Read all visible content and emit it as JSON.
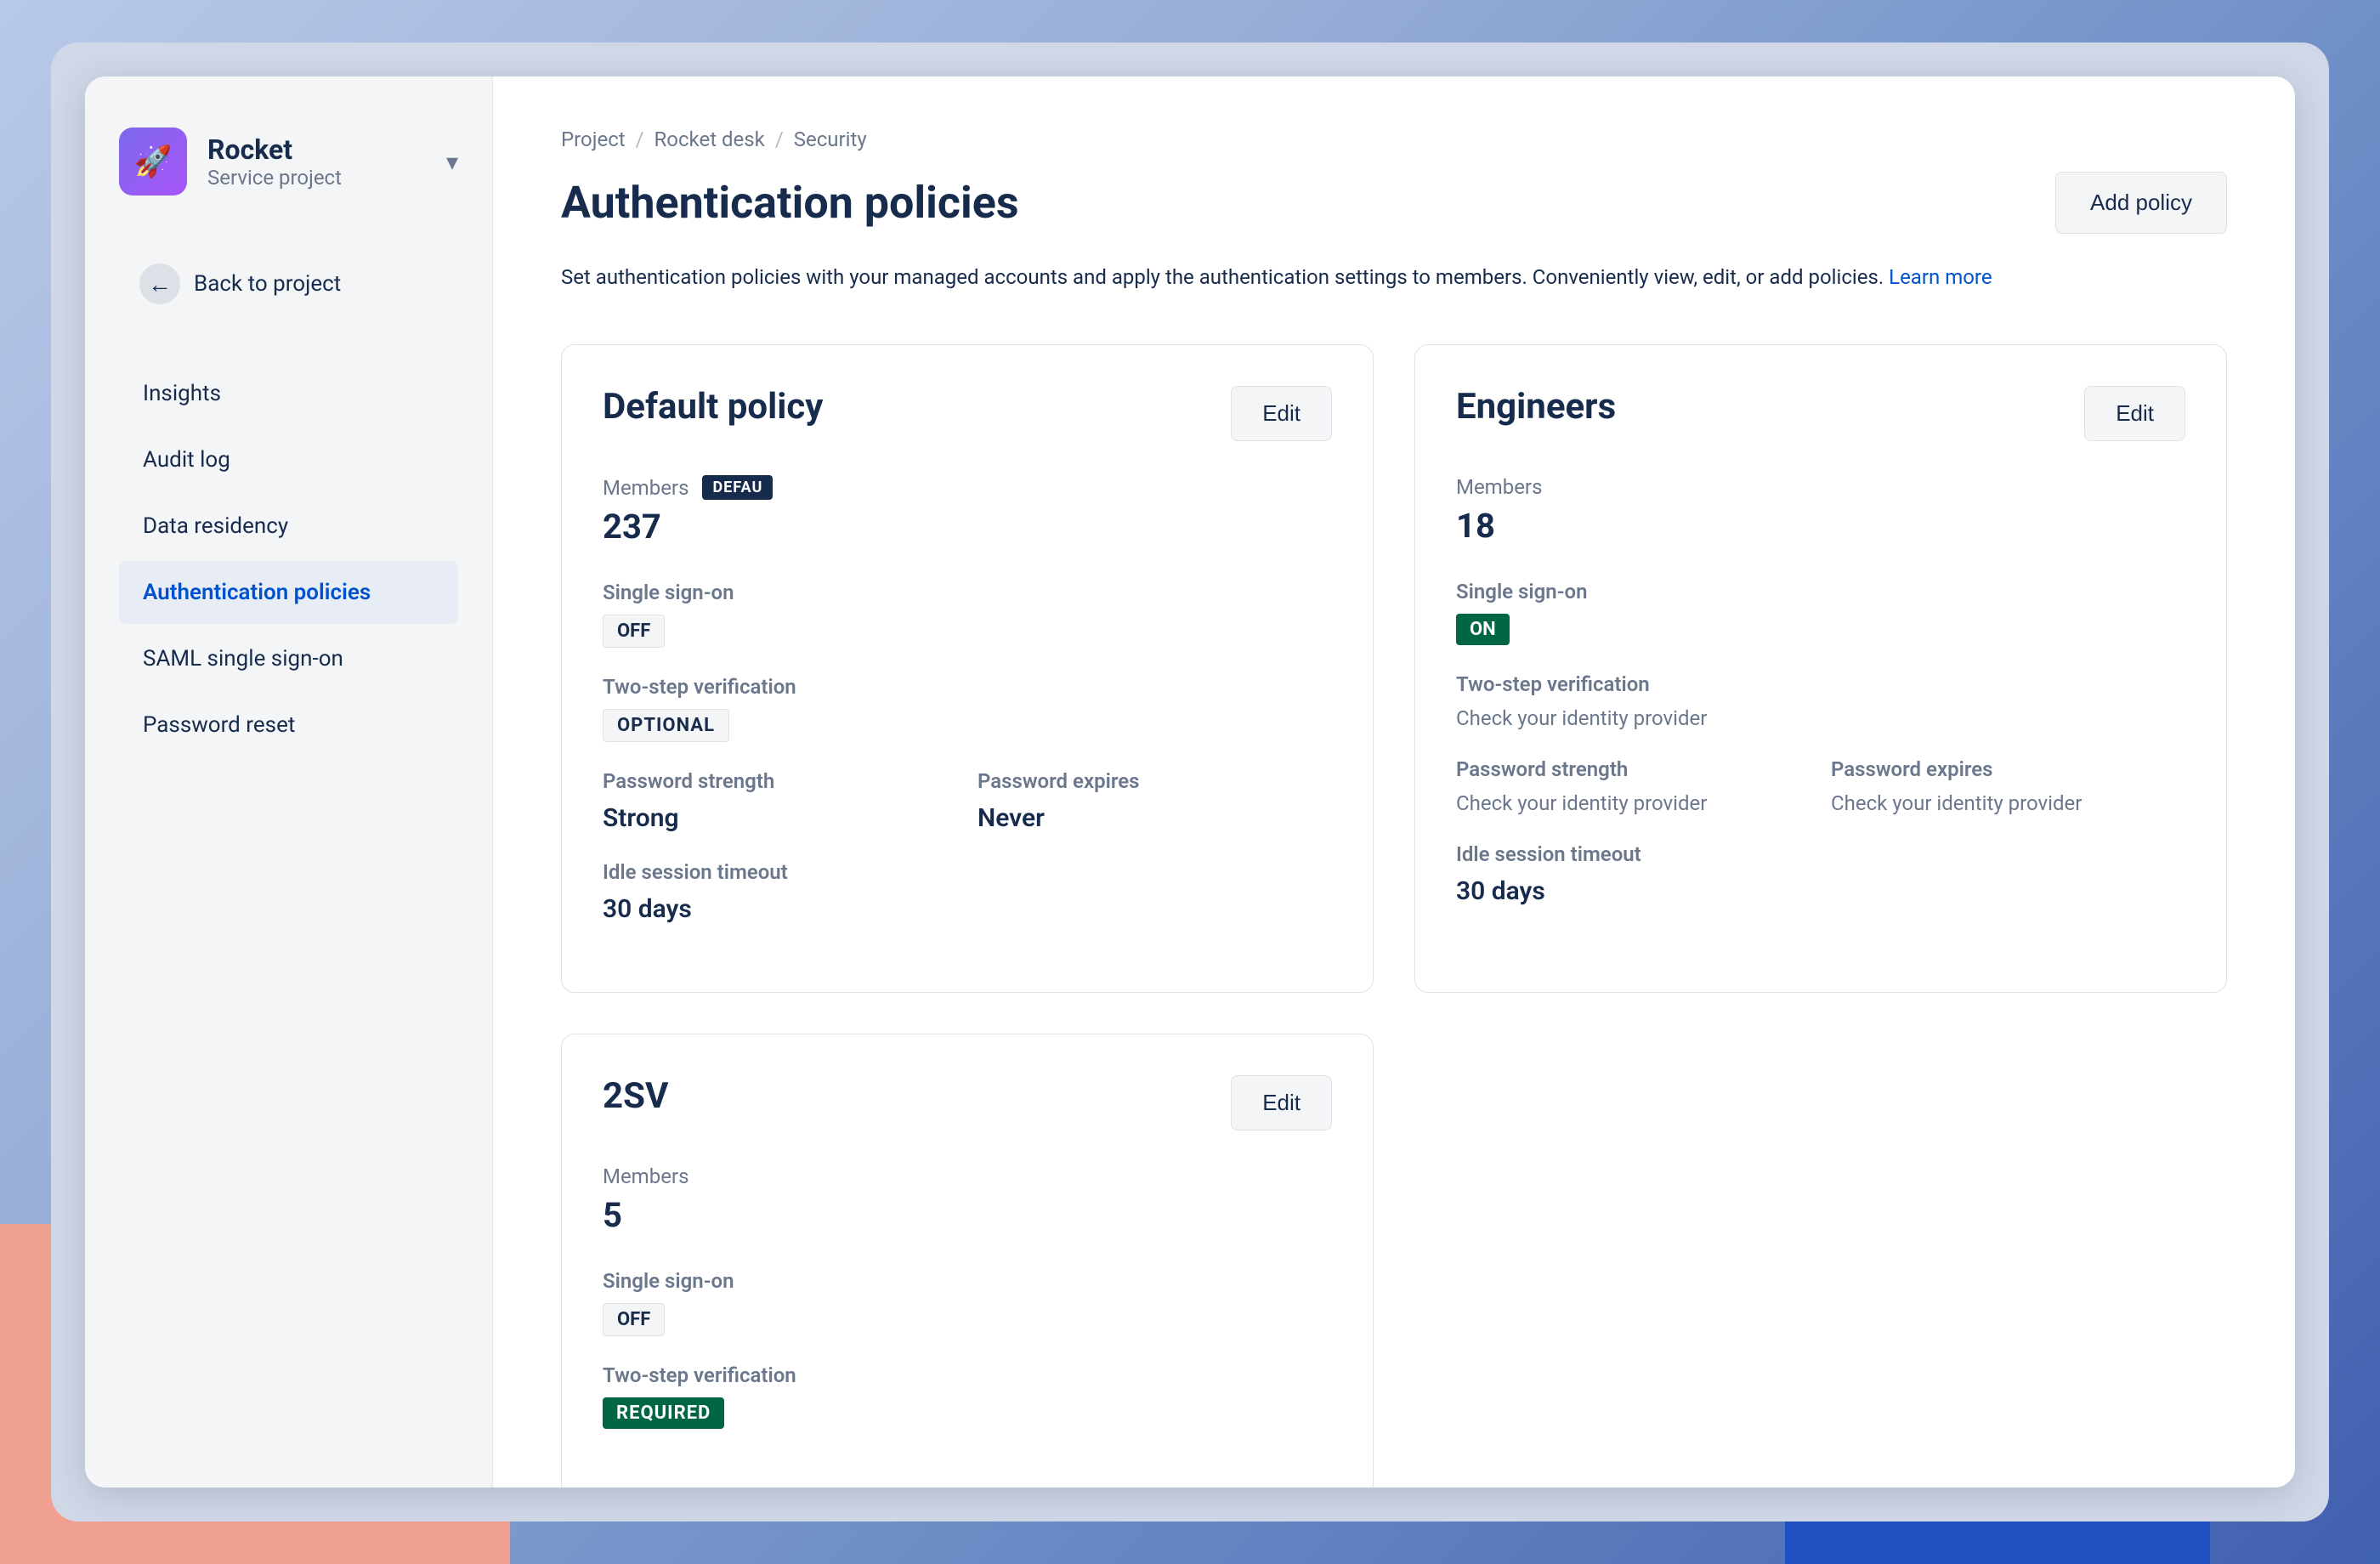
{
  "app": {
    "project_avatar": "🚀",
    "project_name": "Rocket",
    "project_type": "Service project",
    "back_label": "Back to project"
  },
  "breadcrumb": {
    "items": [
      "Project",
      "Rocket desk",
      "Security"
    ],
    "separators": [
      "/",
      "/"
    ]
  },
  "page": {
    "title": "Authentication policies",
    "add_button": "Add policy",
    "description": "Set authentication policies with your managed accounts and apply the authentication settings to members. Conveniently view, edit, or add policies.",
    "learn_more": "Learn more"
  },
  "nav": {
    "items": [
      {
        "label": "Insights",
        "active": false
      },
      {
        "label": "Audit log",
        "active": false
      },
      {
        "label": "Data residency",
        "active": false
      },
      {
        "label": "Authentication policies",
        "active": true
      },
      {
        "label": "SAML single sign-on",
        "active": false
      },
      {
        "label": "Password reset",
        "active": false
      }
    ]
  },
  "policies": [
    {
      "id": "default",
      "title": "Default policy",
      "edit_label": "Edit",
      "members_label": "Members",
      "members_badge": "DEFAU",
      "members_count": "237",
      "sso_label": "Single sign-on",
      "sso_badge": "OFF",
      "sso_type": "off",
      "tsv_label": "Two-step verification",
      "tsv_badge": "OPTIONAL",
      "tsv_type": "optional",
      "pw_strength_label": "Password strength",
      "pw_strength_value": "Strong",
      "pw_expires_label": "Password expires",
      "pw_expires_value": "Never",
      "idle_label": "Idle session timeout",
      "idle_value": "30 days"
    },
    {
      "id": "engineers",
      "title": "Engineers",
      "edit_label": "Edit",
      "members_label": "Members",
      "members_badge": null,
      "members_count": "18",
      "sso_label": "Single sign-on",
      "sso_badge": "ON",
      "sso_type": "on",
      "tsv_label": "Two-step verification",
      "tsv_badge": null,
      "tsv_subtext": "Check your identity provider",
      "pw_strength_label": "Password strength",
      "pw_strength_subtext": "Check your identity provider",
      "pw_expires_label": "Password expires",
      "pw_expires_subtext": "Check your identity provider",
      "idle_label": "Idle session timeout",
      "idle_value": "30 days"
    },
    {
      "id": "2sv",
      "title": "2SV",
      "edit_label": "Edit",
      "members_label": "Members",
      "members_badge": null,
      "members_count": "5",
      "sso_label": "Single sign-on",
      "sso_badge": "OFF",
      "sso_type": "off",
      "tsv_label": "Two-step verification",
      "tsv_badge": "REQUIRED",
      "tsv_type": "required"
    }
  ]
}
